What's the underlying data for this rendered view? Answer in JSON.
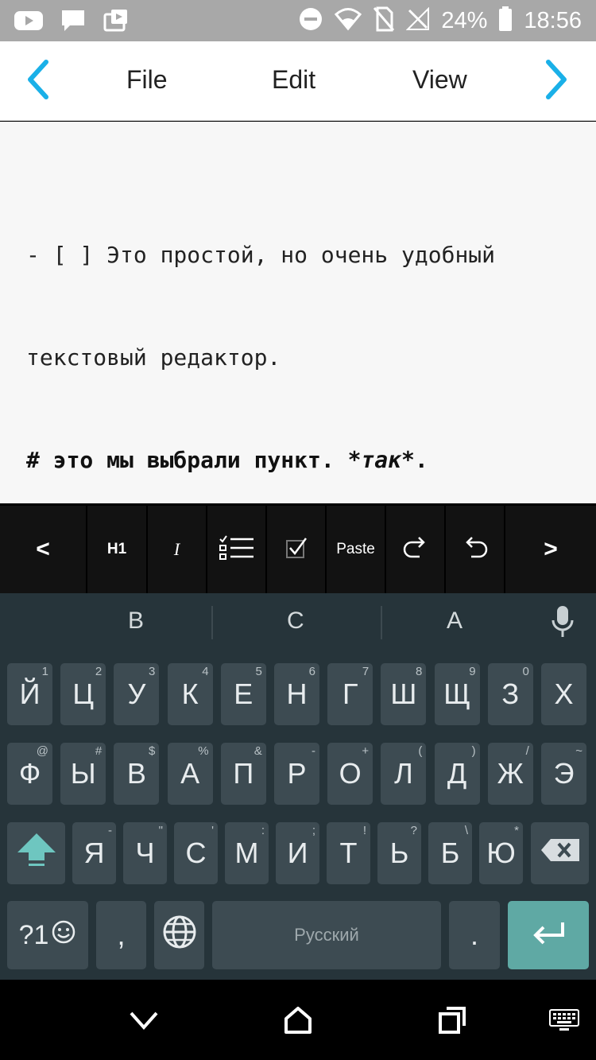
{
  "status_bar": {
    "battery_percent": "24%",
    "time": "18:56",
    "left_icons": [
      "youtube-icon",
      "message-icon",
      "share-icon"
    ],
    "right_icons": [
      "dnd-icon",
      "wifi-icon",
      "no-sim-icon",
      "no-signal-icon",
      "battery-icon"
    ]
  },
  "menu": {
    "items": [
      "File",
      "Edit",
      "View"
    ],
    "accent_color": "#1ab0e8"
  },
  "editor": {
    "line1": "- [ ] Это простой, но очень удобный",
    "line2": "текстовый редактор.",
    "line3_prefix": "# это мы выбрали пункт. ",
    "line3_italic": "*так*",
    "line3_suffix": "."
  },
  "toolbar": {
    "h1_label": "H1",
    "italic_label": "I",
    "paste_label": "Paste",
    "prev_label": "<",
    "next_label": ">"
  },
  "suggestions": [
    "В",
    "С",
    "А"
  ],
  "keyboard": {
    "row1": [
      {
        "label": "Й",
        "hint": "1"
      },
      {
        "label": "Ц",
        "hint": "2"
      },
      {
        "label": "У",
        "hint": "3"
      },
      {
        "label": "К",
        "hint": "4"
      },
      {
        "label": "Е",
        "hint": "5"
      },
      {
        "label": "Н",
        "hint": "6"
      },
      {
        "label": "Г",
        "hint": "7"
      },
      {
        "label": "Ш",
        "hint": "8"
      },
      {
        "label": "Щ",
        "hint": "9"
      },
      {
        "label": "З",
        "hint": "0"
      },
      {
        "label": "Х",
        "hint": ""
      }
    ],
    "row2": [
      {
        "label": "Ф",
        "hint": "@"
      },
      {
        "label": "Ы",
        "hint": "#"
      },
      {
        "label": "В",
        "hint": "$"
      },
      {
        "label": "А",
        "hint": "%"
      },
      {
        "label": "П",
        "hint": "&"
      },
      {
        "label": "Р",
        "hint": "-"
      },
      {
        "label": "О",
        "hint": "+"
      },
      {
        "label": "Л",
        "hint": "("
      },
      {
        "label": "Д",
        "hint": ")"
      },
      {
        "label": "Ж",
        "hint": "/"
      },
      {
        "label": "Э",
        "hint": "~"
      }
    ],
    "row3": [
      {
        "label": "Я",
        "hint": "-"
      },
      {
        "label": "Ч",
        "hint": "\""
      },
      {
        "label": "С",
        "hint": "'"
      },
      {
        "label": "М",
        "hint": ":"
      },
      {
        "label": "И",
        "hint": ";"
      },
      {
        "label": "Т",
        "hint": "!"
      },
      {
        "label": "Ь",
        "hint": "?"
      },
      {
        "label": "Б",
        "hint": "\\"
      },
      {
        "label": "Ю",
        "hint": "*"
      }
    ],
    "symbols_label": "?1",
    "comma_label": ",",
    "period_label": ".",
    "space_label": "Русский",
    "enter_color": "#5fa9a4",
    "shift_color": "#6ec6c0"
  }
}
